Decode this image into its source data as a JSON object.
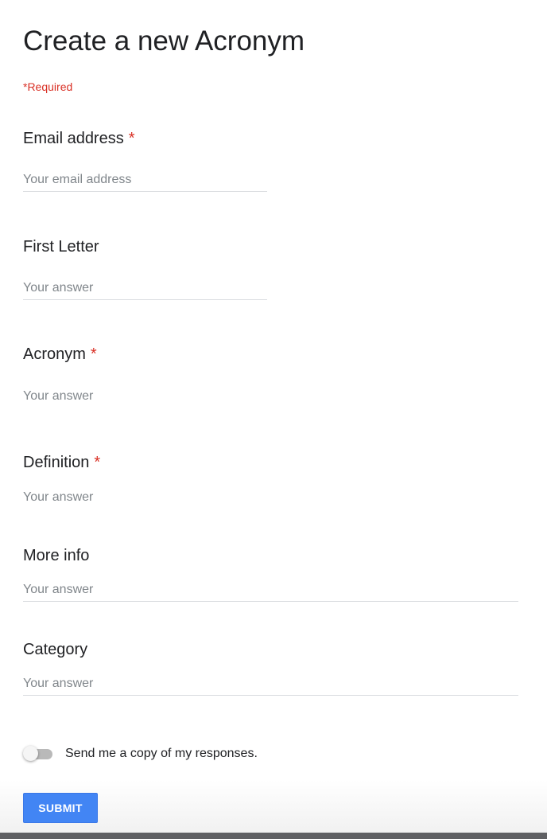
{
  "form": {
    "title": "Create a new Acronym",
    "required_note": "*Required",
    "required_marker": "*",
    "questions": [
      {
        "label": "Email address",
        "required": true,
        "placeholder": "Your email address",
        "value": ""
      },
      {
        "label": "First Letter",
        "required": false,
        "placeholder": "Your answer",
        "value": ""
      },
      {
        "label": "Acronym",
        "required": true,
        "placeholder": "Your answer",
        "value": ""
      },
      {
        "label": "Definition",
        "required": true,
        "placeholder": "Your answer",
        "value": ""
      },
      {
        "label": "More info",
        "required": false,
        "placeholder": "Your answer",
        "value": ""
      },
      {
        "label": "Category",
        "required": false,
        "placeholder": "Your answer",
        "value": ""
      }
    ],
    "copy_toggle": {
      "label": "Send me a copy of my responses.",
      "on": false
    },
    "submit_label": "SUBMIT"
  },
  "colors": {
    "accent": "#4285f4",
    "required": "#d93025",
    "placeholder": "#80868b",
    "underline": "#dadce0"
  }
}
